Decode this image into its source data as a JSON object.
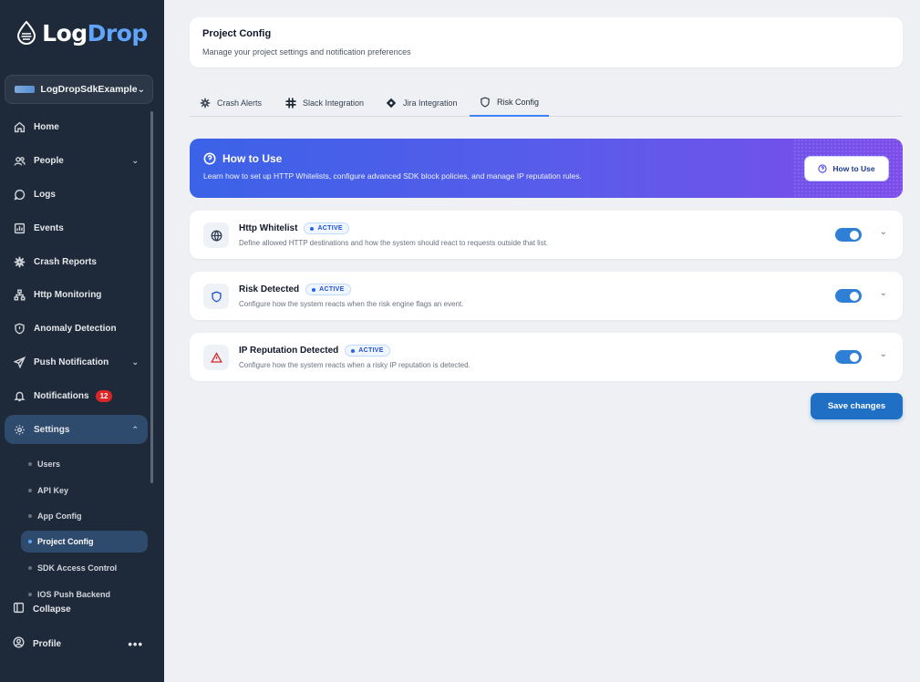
{
  "brand": {
    "name_part1": "Log",
    "name_part2": "Drop",
    "accent": "#60a5fa"
  },
  "project_selector": {
    "value": "LogDropSdkExample"
  },
  "sidebar": {
    "items": [
      {
        "label": "Home",
        "icon": "home-icon"
      },
      {
        "label": "People",
        "icon": "people-icon",
        "expandable": true
      },
      {
        "label": "Logs",
        "icon": "chat-icon"
      },
      {
        "label": "Events",
        "icon": "chart-icon"
      },
      {
        "label": "Crash Reports",
        "icon": "crash-icon"
      },
      {
        "label": "Http Monitoring",
        "icon": "network-icon"
      },
      {
        "label": "Anomaly Detection",
        "icon": "shield-icon"
      },
      {
        "label": "Push Notification",
        "icon": "send-icon",
        "expandable": true
      },
      {
        "label": "Notifications",
        "icon": "bell-icon",
        "badge": "12"
      },
      {
        "label": "Settings",
        "icon": "gear-icon",
        "expanded": true
      }
    ],
    "settings_sub": [
      {
        "label": "Users"
      },
      {
        "label": "API Key"
      },
      {
        "label": "App Config"
      },
      {
        "label": "Project Config",
        "active": true
      },
      {
        "label": "SDK Access Control"
      },
      {
        "label": "IOS Push Backend"
      }
    ],
    "collapse_label": "Collapse",
    "profile_label": "Profile"
  },
  "header": {
    "title": "Project Config",
    "subtitle": "Manage your project settings and notification preferences"
  },
  "tabs": [
    {
      "label": "Crash Alerts",
      "icon": "crash-icon"
    },
    {
      "label": "Slack Integration",
      "icon": "slack-icon"
    },
    {
      "label": "Jira Integration",
      "icon": "jira-icon"
    },
    {
      "label": "Risk Config",
      "icon": "shield-icon",
      "active": true
    }
  ],
  "how_to_use": {
    "title": "How to Use",
    "description": "Learn how to set up HTTP Whitelists, configure advanced SDK block policies, and manage IP reputation rules.",
    "button_label": "How to Use"
  },
  "rules": [
    {
      "title": "Http Whitelist",
      "status": "ACTIVE",
      "description": "Define allowed HTTP destinations and how the system should react to requests outside that list.",
      "enabled": true,
      "icon": "globe-icon"
    },
    {
      "title": "Risk Detected",
      "status": "ACTIVE",
      "description": "Configure how the system reacts when the risk engine flags an event.",
      "enabled": true,
      "icon": "shield-icon"
    },
    {
      "title": "IP Reputation Detected",
      "status": "ACTIVE",
      "description": "Configure how the system reacts when a risky IP reputation is detected.",
      "enabled": true,
      "icon": "warning-icon"
    }
  ],
  "save_label": "Save changes",
  "colors": {
    "sidebar_bg": "#1e2a3a",
    "primary": "#1f6fc5",
    "toggle_on": "#2f7fd6",
    "badge_red": "#dc2626"
  }
}
